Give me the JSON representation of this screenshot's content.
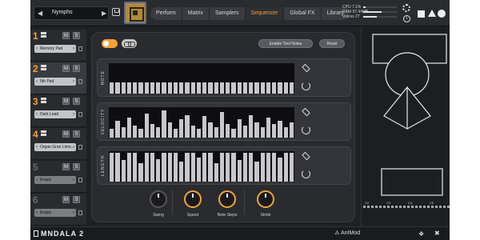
{
  "header": {
    "preset_name": "Nymphs",
    "prev_icon": "chevron-left-icon",
    "next_icon": "chevron-right-icon",
    "tabs": [
      {
        "label": "Perform"
      },
      {
        "label": "Matrix"
      },
      {
        "label": "Samplers"
      },
      {
        "label": "Sequencer",
        "active": true
      },
      {
        "label": "Global FX"
      },
      {
        "label": "Library"
      }
    ],
    "cpu_label": "CPU 7.1%",
    "ram_label": "RAM 97.44MB",
    "voices_label": "Voices 27",
    "cpu_level": 0.07,
    "ram_level": 0.55,
    "voices_level": 0.4
  },
  "layers": [
    {
      "num": "1",
      "preset": "Memory Pad",
      "active": true,
      "mute": "M",
      "solo": "S"
    },
    {
      "num": "2",
      "preset": "5th Pad",
      "active": true,
      "mute": "M",
      "solo": "S"
    },
    {
      "num": "3",
      "preset": "Dark Lead",
      "active": true,
      "mute": "M",
      "solo": "S"
    },
    {
      "num": "4",
      "preset": "Organ Gran Limo...",
      "active": true,
      "mute": "M",
      "solo": "S"
    },
    {
      "num": "5",
      "preset": "Empty",
      "active": false,
      "mute": "M",
      "solo": "S"
    },
    {
      "num": "6",
      "preset": "Empty",
      "active": false,
      "mute": "M",
      "solo": "S"
    }
  ],
  "sequencer": {
    "enable_tied_notes_label": "Enable Tied Notes",
    "reset_label": "Reset",
    "rows": [
      {
        "label": "NOTE",
        "steps": [
          0.38,
          0.38,
          0.38,
          0.38,
          0.38,
          0.38,
          0.38,
          0.38,
          0.38,
          0.38,
          0.38,
          0.38,
          0.38,
          0.38,
          0.38,
          0.38,
          0.38,
          0.38,
          0.38,
          0.38,
          0.38,
          0.38,
          0.38,
          0.38,
          0.38,
          0.38,
          0.38,
          0.38,
          0.38,
          0.38,
          0.38,
          0.38
        ]
      },
      {
        "label": "VELOCITY",
        "steps": [
          0.3,
          0.55,
          0.35,
          0.65,
          0.4,
          0.3,
          0.8,
          0.45,
          0.35,
          0.9,
          0.5,
          0.3,
          0.6,
          0.75,
          0.4,
          0.3,
          0.7,
          0.5,
          0.35,
          0.85,
          0.45,
          0.3,
          0.6,
          0.4,
          0.75,
          0.5,
          0.35,
          0.65,
          0.45,
          0.55,
          0.35,
          0.5
        ]
      },
      {
        "label": "LENGTH",
        "steps": [
          0.95,
          0.95,
          0.7,
          0.95,
          0.95,
          0.6,
          0.95,
          0.95,
          0.75,
          0.95,
          0.95,
          0.95,
          0.65,
          0.95,
          0.95,
          0.8,
          0.95,
          0.95,
          0.6,
          0.95,
          0.95,
          0.95,
          0.7,
          0.95,
          0.95,
          0.65,
          0.95,
          0.95,
          0.95,
          0.8,
          0.95,
          0.95
        ]
      }
    ],
    "knobs": [
      {
        "label": "Swing",
        "hot": false
      },
      {
        "label": "Speed",
        "hot": true
      },
      {
        "label": "Note Steps",
        "hot": true
      },
      {
        "label": "Stride",
        "hot": true
      }
    ]
  },
  "visual": {
    "octaves": [
      "C2",
      "C3",
      "C4",
      "C5"
    ]
  },
  "footer": {
    "product": "MNDALA 2",
    "brand": "Ⲁ AnIMod"
  },
  "colors": {
    "accent": "#f0a33a",
    "background": "#1f2023"
  }
}
